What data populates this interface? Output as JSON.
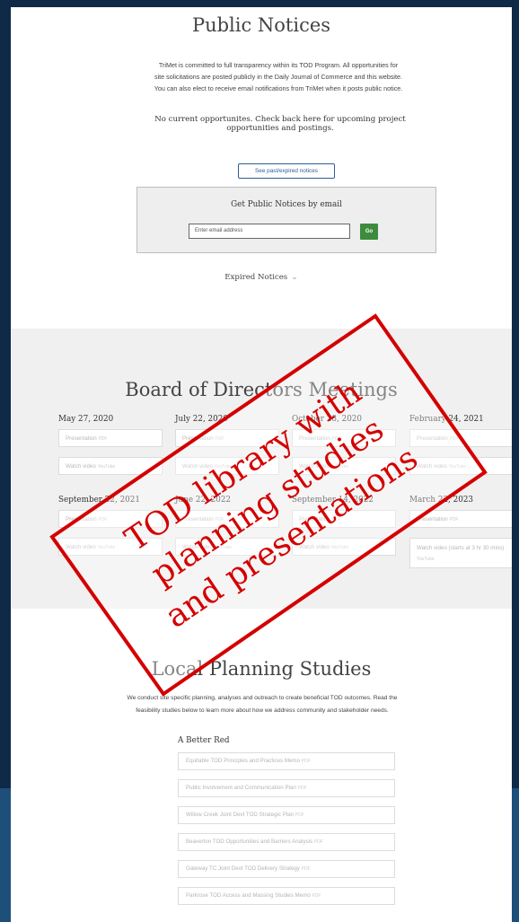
{
  "public_notices": {
    "title": "Public Notices",
    "intro_line1": "TriMet is committed to full transparency within its TOD Program. All opportunities for",
    "intro_line2": "site solicitations are posted publicly in the Daily Journal of Commerce and this website.",
    "intro_line3": "You can also elect to receive email notifications from TriMet when it posts public notice.",
    "no_opportunities_line1": "No current opportunites. Check back here for upcoming project",
    "no_opportunities_line2": "opportunities and postings.",
    "see_past_button": "See past/expired notices",
    "email_title": "Get Public Notices by email",
    "email_placeholder": "Enter email address",
    "go_button": "Go",
    "expired_notices": "Expired Notices"
  },
  "board": {
    "title": "Board of Directors Meetings",
    "meetings": [
      {
        "date": "May 27, 2020",
        "link1": "Presentation",
        "tag1": "PDF",
        "link2": "Watch video",
        "tag2": "YouTube"
      },
      {
        "date": "July 22, 2020",
        "link1": "Presentation",
        "tag1": "PDF",
        "link2": "Watch video",
        "tag2": "YouTube"
      },
      {
        "date": "October 28, 2020",
        "link1": "Presentation",
        "tag1": "PDF",
        "link2": "Watch video",
        "tag2": "YouTube"
      },
      {
        "date": "February 24, 2021",
        "link1": "Presentation",
        "tag1": "PDF",
        "link2": "Watch video",
        "tag2": "YouTube"
      },
      {
        "date": "September 22, 2021",
        "link1": "Presentation",
        "tag1": "PDF",
        "link2": "Watch video",
        "tag2": "YouTube"
      },
      {
        "date": "June 22, 2022",
        "link1": "Presentation",
        "tag1": "PDF",
        "link2": "Watch video",
        "tag2": "YouTube"
      },
      {
        "date": "September 14, 2022",
        "link1": "Presentation",
        "tag1": "PDF",
        "link2": "Watch video",
        "tag2": "YouTube"
      },
      {
        "date": "March 22, 2023",
        "link1": "Presentation",
        "tag1": "PDF",
        "link2": "Watch video (starts at 3 hr 30 mins)",
        "tag2": "YouTube"
      }
    ]
  },
  "planning": {
    "title": "Local Planning Studies",
    "intro_line1": "We conduct site specific planning, analyses and outreach to create beneficial TOD outcomes. Read the",
    "intro_line2": "feasibility studies below to learn more about how we address community and stakeholder needs.",
    "group_title": "A Better Red",
    "pdf_tag": "PDF",
    "studies": [
      "Equitable TOD Principles and Practices Memo",
      "Public Involvement and Communication Plan",
      "Willow Creek Joint Devt TOD Strategic Plan",
      "Beaverton TOD Opportunities and Barriers Analysis",
      "Gateway TC Joint Devt TOD Delivery Strategy",
      "Parkrose TOD Access and Massing Studies Memo"
    ]
  },
  "stamp": {
    "line1": "TOD library with",
    "line2": "planning studies",
    "line3": "and presentations",
    "color": "#d40000"
  },
  "colors": {
    "frame": "#0e2a47",
    "link_blue": "#2d5e93",
    "go_green": "#3d8b3d"
  }
}
